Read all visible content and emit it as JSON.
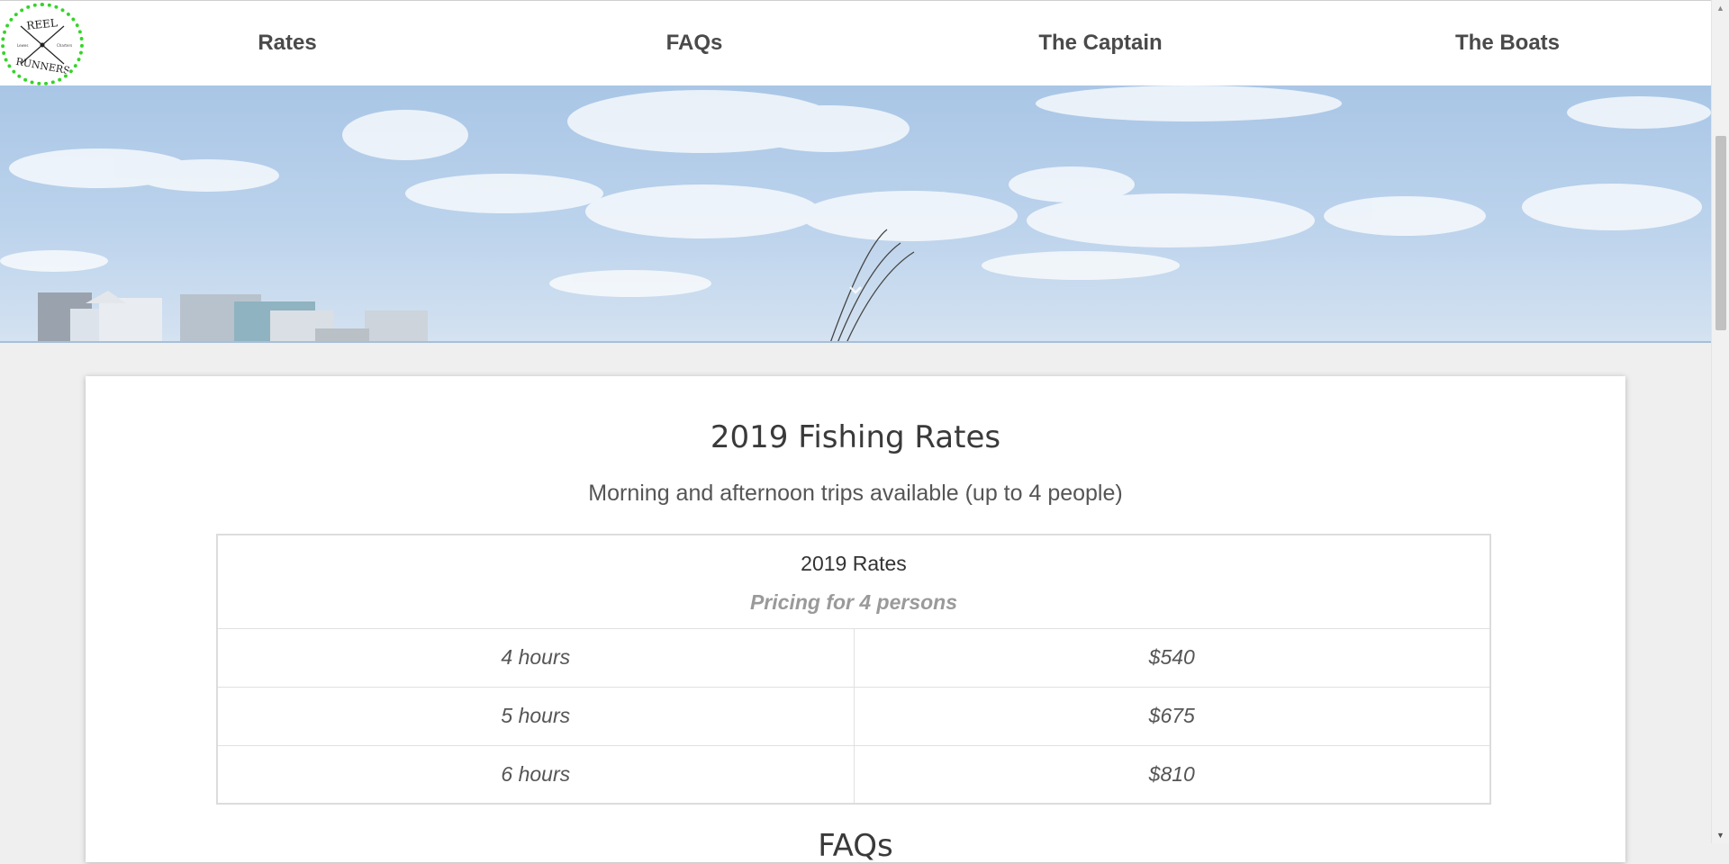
{
  "logo": {
    "top_text": "REEL",
    "bottom_text": "RUNNERS",
    "left_small": "Lewes",
    "right_small": "Charters"
  },
  "nav": {
    "items": [
      {
        "label": "Rates"
      },
      {
        "label": "FAQs"
      },
      {
        "label": "The Captain"
      },
      {
        "label": "The Boats"
      }
    ]
  },
  "rates_section": {
    "title": "2019 Fishing Rates",
    "subtitle": "Morning and afternoon trips available (up to 4 people)",
    "table": {
      "title": "2019 Rates",
      "note": "Pricing for 4 persons",
      "rows": [
        {
          "duration": "4 hours",
          "price": "$540"
        },
        {
          "duration": "5 hours",
          "price": "$675"
        },
        {
          "duration": "6 hours",
          "price": "$810"
        }
      ]
    }
  },
  "next_section_title": "FAQs",
  "colors": {
    "logo_border": "#35d42a",
    "nav_text": "#4a4a4a",
    "page_bg": "#efefef",
    "sky": "#a9c6e6"
  },
  "icons": {
    "scroll_down": "chevron-down-icon"
  }
}
